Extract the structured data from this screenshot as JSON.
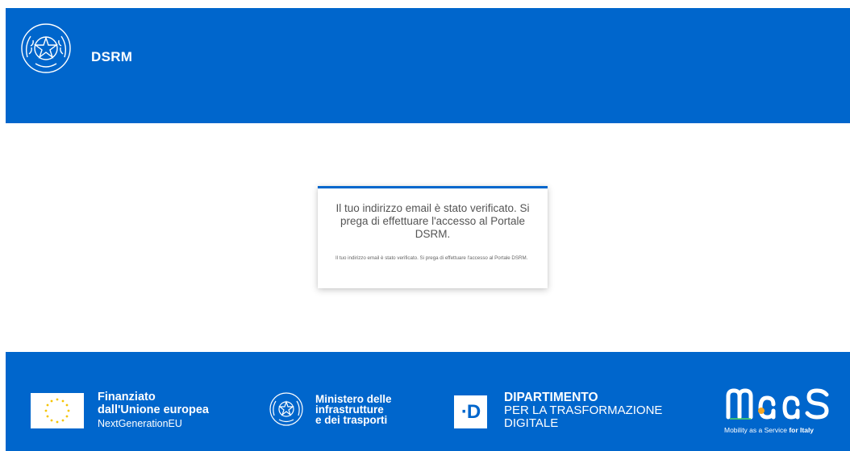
{
  "header": {
    "title": "DSRM",
    "emblem_icon": "republic-emblem-icon"
  },
  "card": {
    "heading": "Il tuo indirizzo email è stato verificato. Si prega di effettuare l'accesso al Portale DSRM.",
    "body": "Il tuo indirizzo email è stato verificato. Si prega di effettuare l'accesso al Portale DSRM."
  },
  "footer": {
    "eu": {
      "line1": "Finanziato",
      "line2": "dall'Unione europea",
      "line3": "NextGenerationEU",
      "icon": "eu-flag-icon"
    },
    "ministry": {
      "line1": "Ministero delle",
      "line2": "infrastrutture",
      "line3": "e dei trasporti",
      "icon": "republic-emblem-icon"
    },
    "department": {
      "logo_text": "·D",
      "line1": "DIPARTIMENTO",
      "line2": "PER LA TRASFORMAZIONE",
      "line3": "DIGITALE"
    },
    "maas": {
      "logo_text": "MaaS",
      "tagline": "Mobility as a Service",
      "tagline_bold": "for Italy"
    }
  },
  "colors": {
    "primary": "#0066cc",
    "card_text": "#555555",
    "background": "#ffffff"
  }
}
